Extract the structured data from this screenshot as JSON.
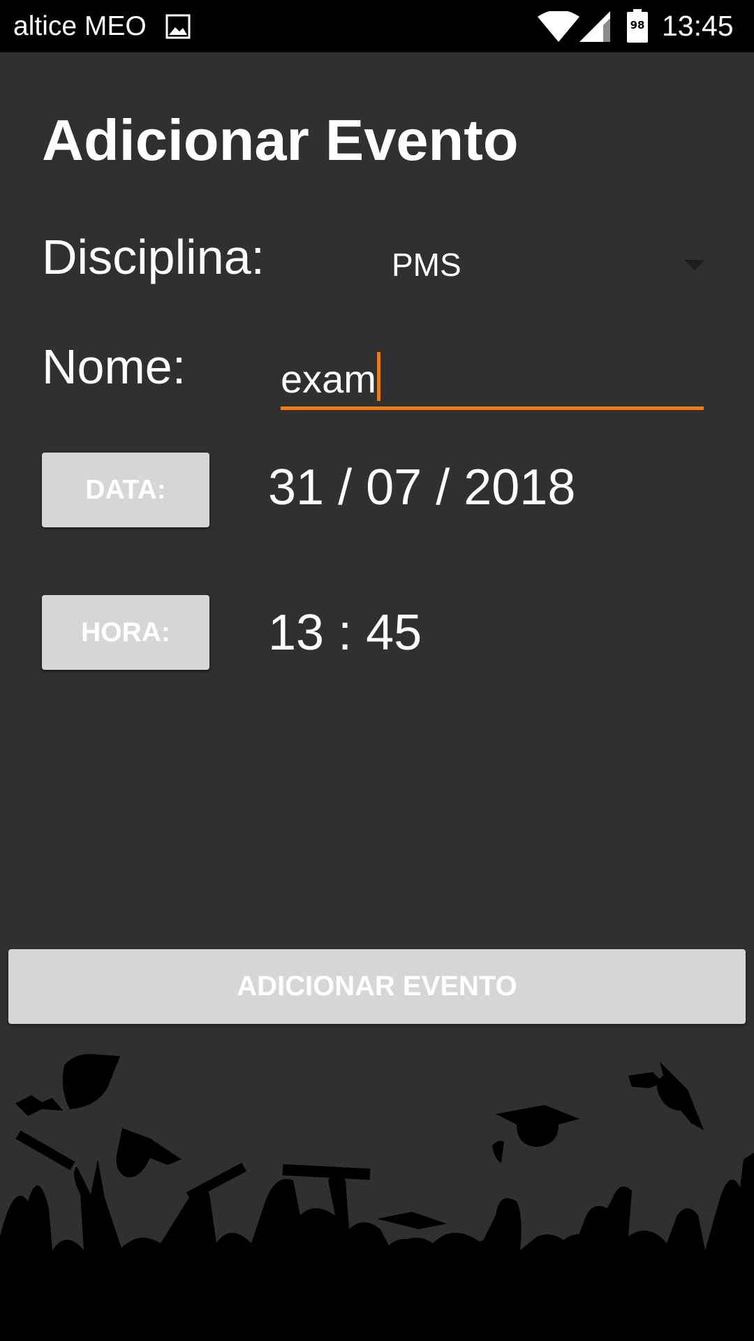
{
  "status_bar": {
    "carrier": "altice MEO",
    "battery_level": "98",
    "time": "13:45",
    "icons": [
      "gallery-icon",
      "wifi-icon",
      "signal-icon",
      "battery-icon"
    ]
  },
  "page": {
    "title": "Adicionar Evento"
  },
  "form": {
    "disciplina_label": "Disciplina:",
    "disciplina_value": "PMS",
    "nome_label": "Nome:",
    "nome_value": "exam",
    "data_button": "DATA:",
    "date_value": "31 / 07 / 2018",
    "hora_button": "HORA:",
    "time_value": "13 : 45"
  },
  "actions": {
    "add_event_button": "ADICIONAR EVENTO"
  },
  "colors": {
    "background": "#303030",
    "accent": "#e87d1e",
    "button_bg": "#d5d7d7"
  }
}
